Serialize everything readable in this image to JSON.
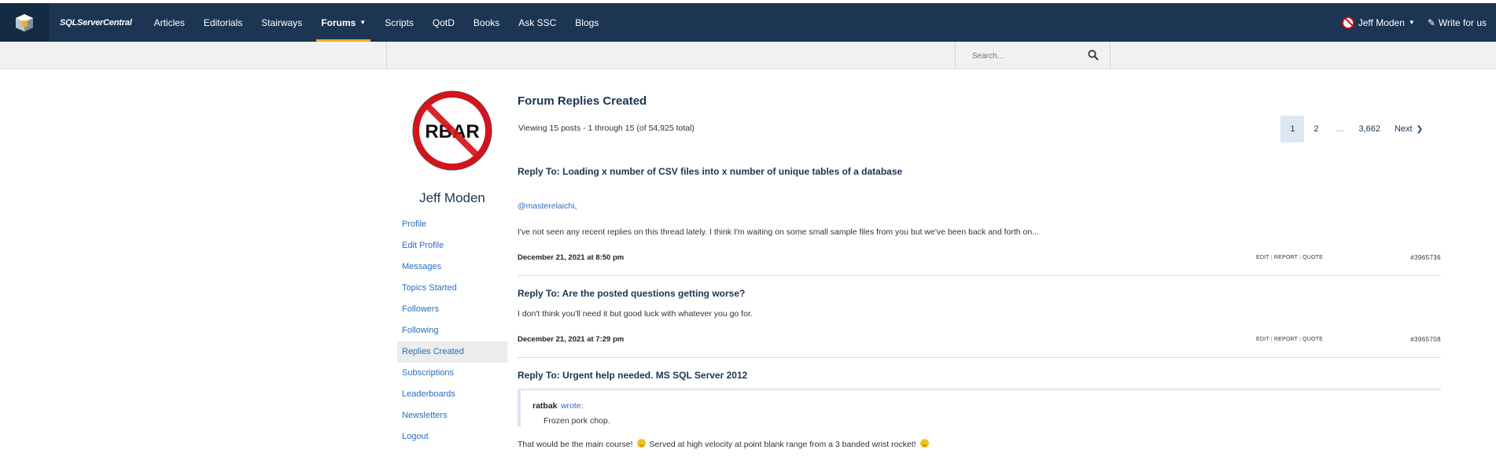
{
  "header": {
    "brand": "SQLServerCentral",
    "nav": [
      {
        "label": "Articles"
      },
      {
        "label": "Editorials"
      },
      {
        "label": "Stairways"
      },
      {
        "label": "Forums",
        "active": true
      },
      {
        "label": "Scripts"
      },
      {
        "label": "QotD"
      },
      {
        "label": "Books"
      },
      {
        "label": "Ask SSC"
      },
      {
        "label": "Blogs"
      }
    ],
    "user_name": "Jeff Moden",
    "write_label": "Write for us",
    "colors": {
      "bar": "#1b3553",
      "active_underline": "#f2b21b"
    }
  },
  "search": {
    "placeholder": "Search..."
  },
  "sidebar": {
    "avatar_text": "RBAR",
    "name": "Jeff Moden",
    "links": [
      {
        "label": "Profile"
      },
      {
        "label": "Edit Profile"
      },
      {
        "label": "Messages"
      },
      {
        "label": "Topics Started"
      },
      {
        "label": "Followers"
      },
      {
        "label": "Following"
      },
      {
        "label": "Replies Created",
        "active": true
      },
      {
        "label": "Subscriptions"
      },
      {
        "label": "Leaderboards"
      },
      {
        "label": "Newsletters"
      },
      {
        "label": "Logout"
      }
    ]
  },
  "main": {
    "title": "Forum Replies Created",
    "viewing": "Viewing 15 posts - 1 through 15 (of 54,925 total)",
    "pagination": {
      "pages": [
        "1",
        "2",
        "…",
        "3,662"
      ],
      "current": "1",
      "next": "Next"
    },
    "post_actions": {
      "edit": "EDIT",
      "report": "REPORT",
      "quote": "QUOTE"
    },
    "posts": [
      {
        "title": "Reply To: Loading x number of CSV files into x number of unique tables of a database",
        "mention": "@masterelaichi",
        "mention_suffix": ",",
        "body": "I've not seen any recent replies on this thread lately.  I think I'm waiting on some small sample files from you but we've been back and forth on...",
        "date": "December 21, 2021 at 8:50 pm",
        "id": "#3965736"
      },
      {
        "title": "Reply To: Are the posted questions getting worse?",
        "body": "I don't think you'll need it but good luck with whatever you go for.",
        "date": "December 21, 2021 at 7:29 pm",
        "id": "#3965708"
      },
      {
        "title": "Reply To: Urgent help needed. MS SQL Server 2012",
        "quote_author": "ratbak",
        "quote_wrote": "wrote:",
        "quote_text": "Frozen pork chop.",
        "body_part1": "That would be the main course!",
        "body_part2": "Served at high velocity at point blank range from a 3 banded wrist rocket!"
      }
    ]
  }
}
